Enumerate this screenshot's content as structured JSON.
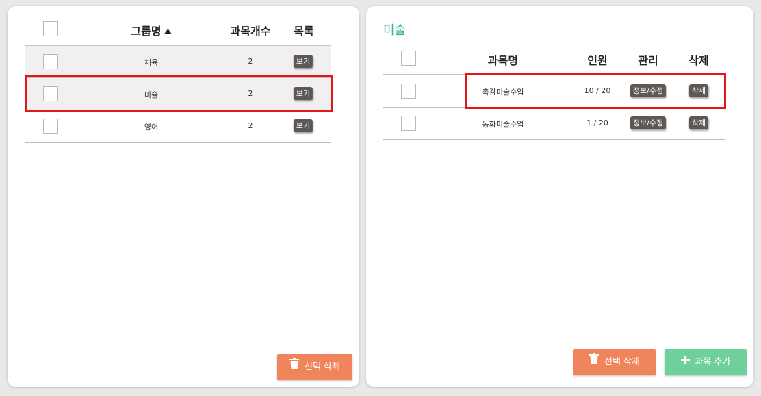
{
  "colors": {
    "accent_teal": "#2fb39b",
    "delete_button": "#f0845a",
    "add_button": "#6fd09b",
    "tag_button": "#5e5754",
    "highlight": "#e01818"
  },
  "group_table": {
    "headers": {
      "name": "그룹명",
      "count": "과목개수",
      "list": "목록"
    },
    "sort_icon": "sort-ascending-icon",
    "rows": [
      {
        "name": "체육",
        "count": "2",
        "view_label": "보기"
      },
      {
        "name": "미술",
        "count": "2",
        "view_label": "보기"
      },
      {
        "name": "영어",
        "count": "2",
        "view_label": "보기"
      }
    ],
    "delete_selected_label": "선택 삭제"
  },
  "subject_panel": {
    "title": "미술",
    "headers": {
      "name": "과목명",
      "members": "인원",
      "manage": "관리",
      "delete": "삭제"
    },
    "rows": [
      {
        "name": "촉감미술수업",
        "members": "10 / 20",
        "edit_label": "정보/수정",
        "delete_label": "삭제"
      },
      {
        "name": "동화미술수업",
        "members": "1 / 20",
        "edit_label": "정보/수정",
        "delete_label": "삭제"
      }
    ],
    "delete_selected_label": "선택 삭제",
    "add_label": "과목 추가"
  }
}
